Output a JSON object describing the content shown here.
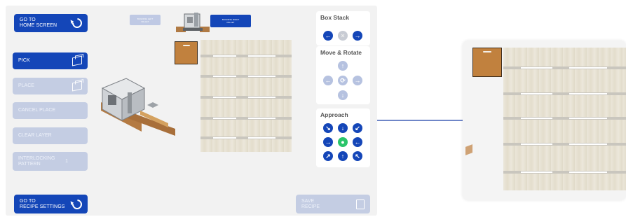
{
  "left_panel": {
    "home_button": "GO TO\nHOME SCREEN",
    "pick_button": "PICK",
    "place_button": "PLACE",
    "cancel_place_button": "CANCEL PLACE",
    "clear_layer_button": "CLEAR LAYER",
    "interlocking_button": "INTERLOCKING\nPATTERN",
    "interlocking_value": "1",
    "recipe_settings_button": "GO TO\nRECIPE SETTINGS"
  },
  "pallet_tags": {
    "left_pallet": "BUILDING LEFT\nPALLET",
    "right_pallet": "BUILDING RIGHT\nPALLET"
  },
  "box_stack": {
    "title": "Box Stack"
  },
  "move_rotate": {
    "title": "Move & Rotate"
  },
  "approach": {
    "title": "Approach"
  },
  "save_button": "SAVE\nRECIPE",
  "colors": {
    "primary": "#1446b8",
    "disabled": "#c4cde3",
    "approach_center": "#29c46a",
    "carton": "#c1813e"
  },
  "icons": {
    "home": "refresh-icon",
    "pick": "box-icon",
    "save": "clipboard-icon"
  }
}
